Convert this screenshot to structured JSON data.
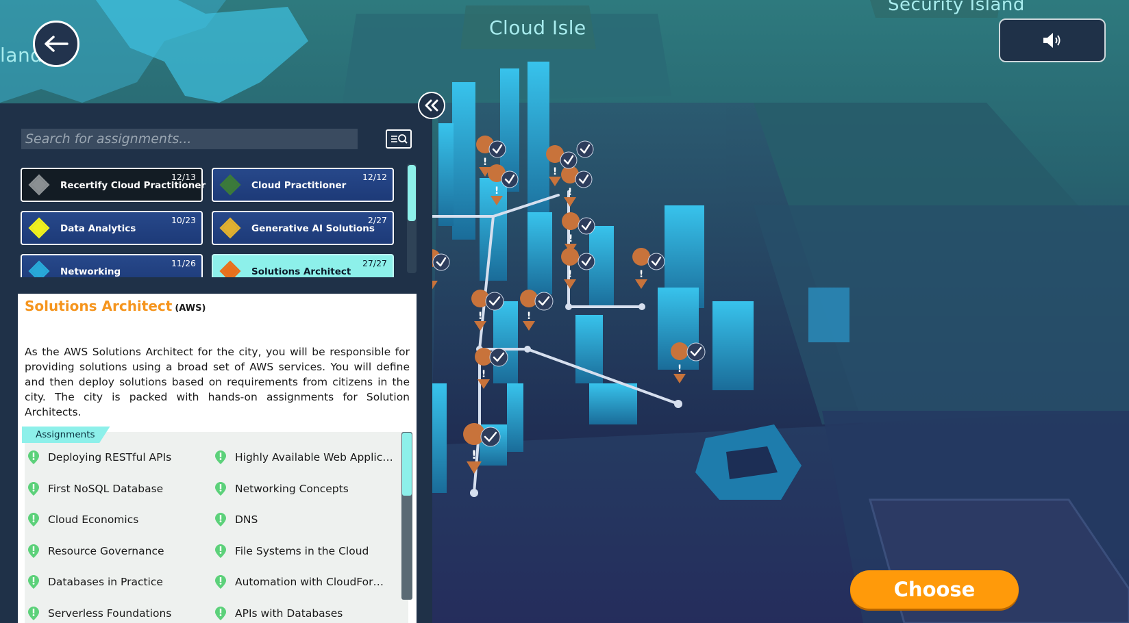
{
  "scene": {
    "labels": {
      "left": "land",
      "center": "Cloud Isle",
      "right": "Security Island"
    }
  },
  "controls": {
    "back_icon": "arrow-left-icon",
    "sound_icon": "speaker-icon",
    "collapse_icon": "chevron-double-left-icon"
  },
  "search": {
    "placeholder": "Search for assignments...",
    "icon": "search-icon"
  },
  "roles": [
    {
      "name": "Recertify Cloud Practitioner",
      "count": "12/13",
      "color": "#8a8f92",
      "style": "dark"
    },
    {
      "name": "Cloud Practitioner",
      "count": "12/12",
      "color": "#3b7a3a",
      "style": "normal"
    },
    {
      "name": "Data Analytics",
      "count": "10/23",
      "color": "#f0f01e",
      "style": "normal"
    },
    {
      "name": "Generative AI Solutions",
      "count": "2/27",
      "color": "#e0b030",
      "style": "normal"
    },
    {
      "name": "Networking",
      "count": "11/26",
      "color": "#28a8d8",
      "style": "normal"
    },
    {
      "name": "Solutions Architect",
      "count": "27/27",
      "color": "#e8701c",
      "style": "selected"
    }
  ],
  "detail": {
    "title": "Solutions Architect",
    "tag": "(AWS)",
    "description": "As the AWS Solutions Architect for the city, you will be responsible for providing solutions using a broad set of AWS services. You will define and then deploy solutions based on requirements from citizens in the city. The city is packed with hands-on assignments for Solution Architects.",
    "assignments_label": "Assignments",
    "assignments": [
      "Deploying RESTful APIs",
      "Highly Available Web Applic…",
      "First NoSQL Database",
      "Networking Concepts",
      "Cloud Economics",
      "DNS",
      "Resource Governance",
      "File Systems in the Cloud",
      "Databases in Practice",
      "Automation with CloudFor…",
      "Serverless Foundations",
      "APIs with Databases"
    ],
    "pin_color": "#5cd17a"
  },
  "choose": {
    "label": "Choose",
    "color": "#ff9a0a"
  }
}
